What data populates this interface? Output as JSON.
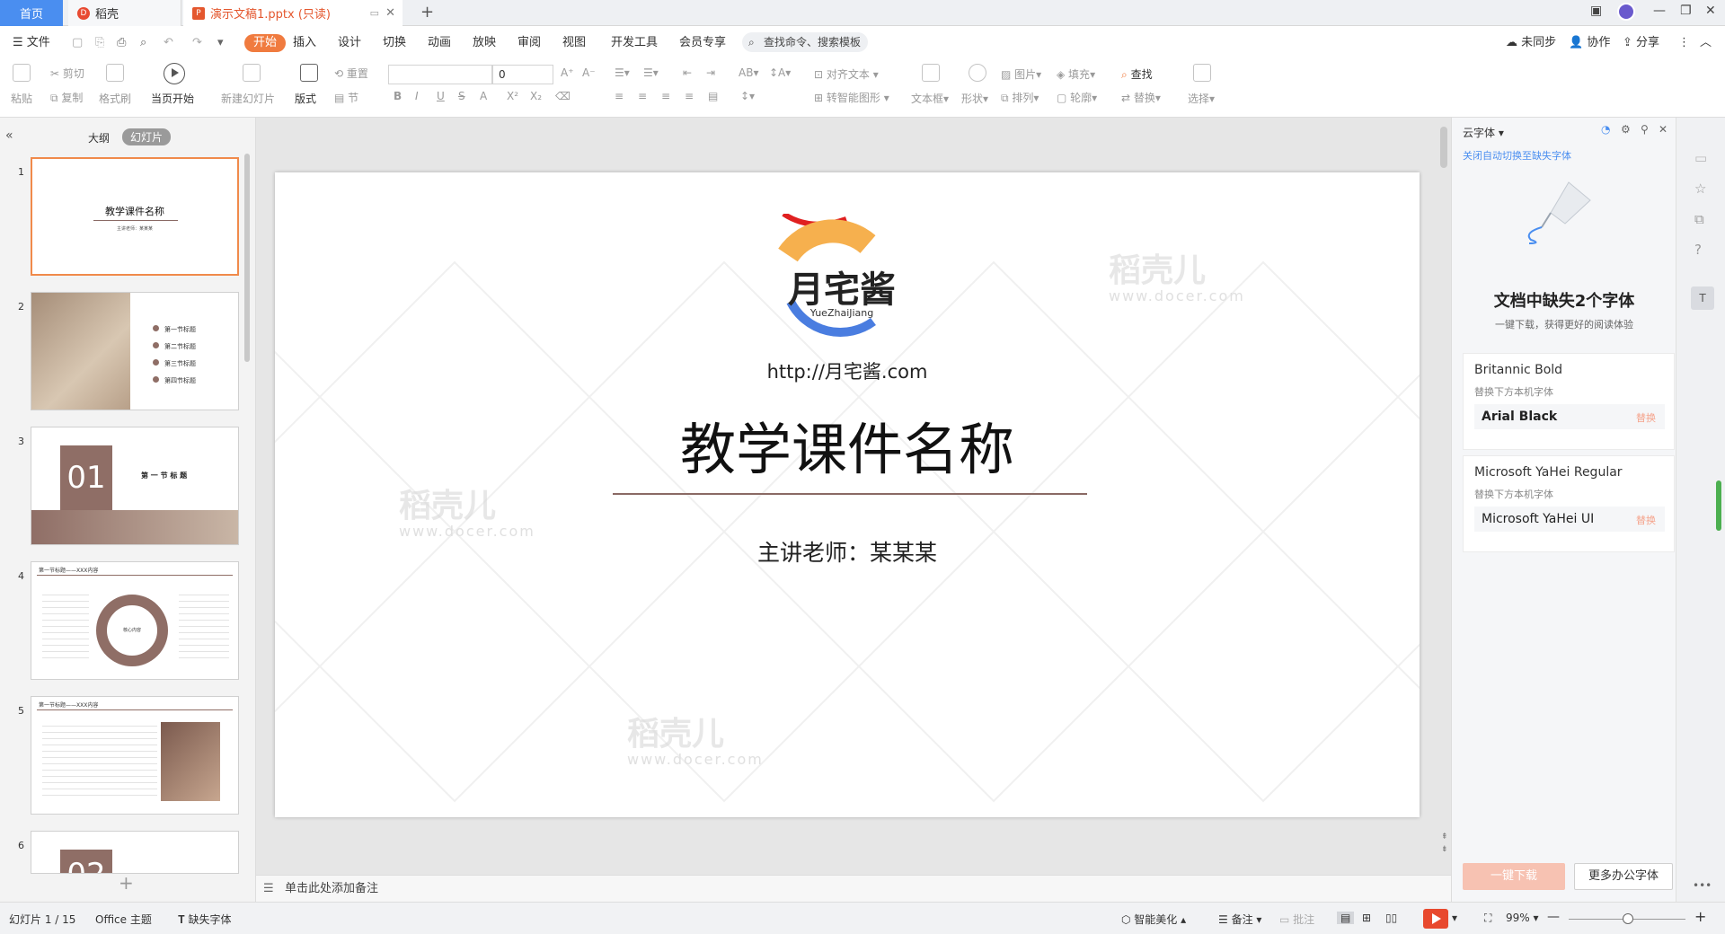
{
  "titlebar": {
    "home_tab": "首页",
    "doc_tab": "稻壳",
    "doc_tab_icon": "D",
    "ppt_tab": "演示文稿1.pptx (只读)",
    "ppt_tab_icon": "P",
    "close": "✕",
    "new_tab": "+"
  },
  "menubar": {
    "file": "文件",
    "items": [
      "开始",
      "插入",
      "设计",
      "切换",
      "动画",
      "放映",
      "审阅",
      "视图",
      "开发工具",
      "会员专享"
    ],
    "search": "查找命令、搜索模板",
    "unsynced": "未同步",
    "collab": "协作",
    "share": "分享"
  },
  "ribbon": {
    "paste": "粘贴",
    "cut": "剪切",
    "copy": "复制",
    "format_painter": "格式刷",
    "start_from_current": "当页开始",
    "new_slide": "新建幻灯片",
    "layout": "版式",
    "reset": "重置",
    "section": "节",
    "font_size": "0",
    "align_text": "对齐文本",
    "to_smartart": "转智能图形",
    "textbox": "文本框",
    "shape": "形状",
    "picture": "图片",
    "arrange": "排列",
    "fill": "填充",
    "outline": "轮廓",
    "find": "查找",
    "replace": "替换",
    "select": "选择"
  },
  "leftpane": {
    "outline_tab": "大纲",
    "slides_tab": "幻灯片",
    "thumbs": [
      {
        "num": "1",
        "title": "教学课件名称",
        "sub": "主讲老师：某某某"
      },
      {
        "num": "2",
        "items": [
          "第一节标题",
          "第二节标题",
          "第三节标题",
          "第四节标题"
        ]
      },
      {
        "num": "3",
        "big": "01",
        "title": "第 一 节 标 题"
      },
      {
        "num": "4",
        "title": "第一节标题——XXX内容",
        "center": "核心内容"
      },
      {
        "num": "5",
        "title": "第一节标题——XXX内容"
      },
      {
        "num": "6",
        "big": "02"
      }
    ]
  },
  "slide": {
    "logo_text": "月宅酱",
    "logo_sub": "YueZhaiJiang",
    "url": "http://月宅酱.com",
    "title": "教学课件名称",
    "subtitle": "主讲老师：某某某",
    "watermark": "稻壳儿",
    "watermark_sub": "www.docer.com"
  },
  "notes": {
    "placeholder": "单击此处添加备注"
  },
  "rightpanel": {
    "title": "云字体",
    "link": "关闭自动切换至缺失字体",
    "heading": "文档中缺失2个字体",
    "subheading": "一键下载，获得更好的阅读体验",
    "fonts": [
      {
        "missing": "Britannic Bold",
        "hint": "替换下方本机字体",
        "replacement": "Arial Black",
        "action": "替换"
      },
      {
        "missing": "Microsoft YaHei Regular",
        "hint": "替换下方本机字体",
        "replacement": "Microsoft YaHei UI",
        "action": "替换"
      }
    ],
    "download_btn": "一键下载",
    "more_btn": "更多办公字体"
  },
  "statusbar": {
    "slide_info": "幻灯片 1 / 15",
    "theme": "Office 主题",
    "missing_fonts": "缺失字体",
    "beautify": "智能美化",
    "notes": "备注",
    "comments": "批注",
    "zoom": "99%"
  },
  "colors": {
    "accent": "#f07b3f",
    "tab_blue": "#4a8ef0",
    "slide_line": "#8a6a65",
    "thumb_brown": "#8f6e66"
  }
}
